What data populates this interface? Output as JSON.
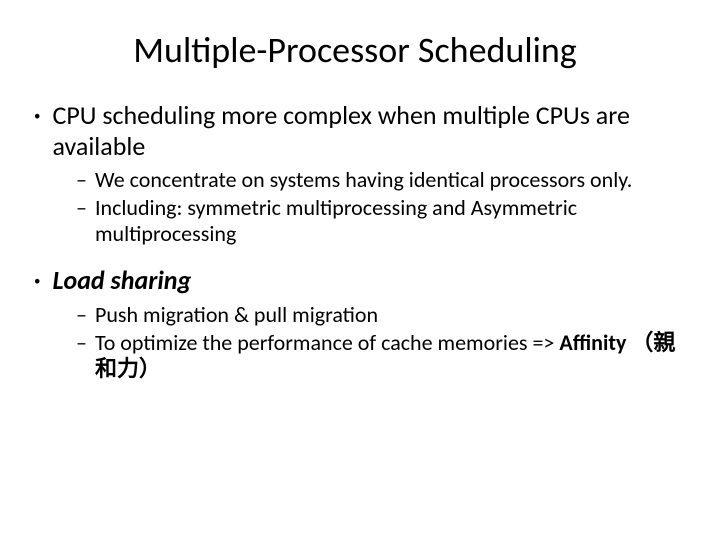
{
  "title": "Multiple-Processor Scheduling",
  "b1": {
    "text": "CPU scheduling more complex when multiple CPUs are available",
    "sub1": "We concentrate on systems having identical processors only.",
    "sub2": "Including: symmetric multiprocessing and Asymmetric multiprocessing"
  },
  "b2": {
    "text": "Load sharing",
    "sub1": "Push migration & pull migration",
    "sub2_prefix": "To optimize the performance of cache memories => ",
    "sub2_bold": "Affinity （親和力）"
  },
  "markers": {
    "dot": "•",
    "dash": "–"
  }
}
